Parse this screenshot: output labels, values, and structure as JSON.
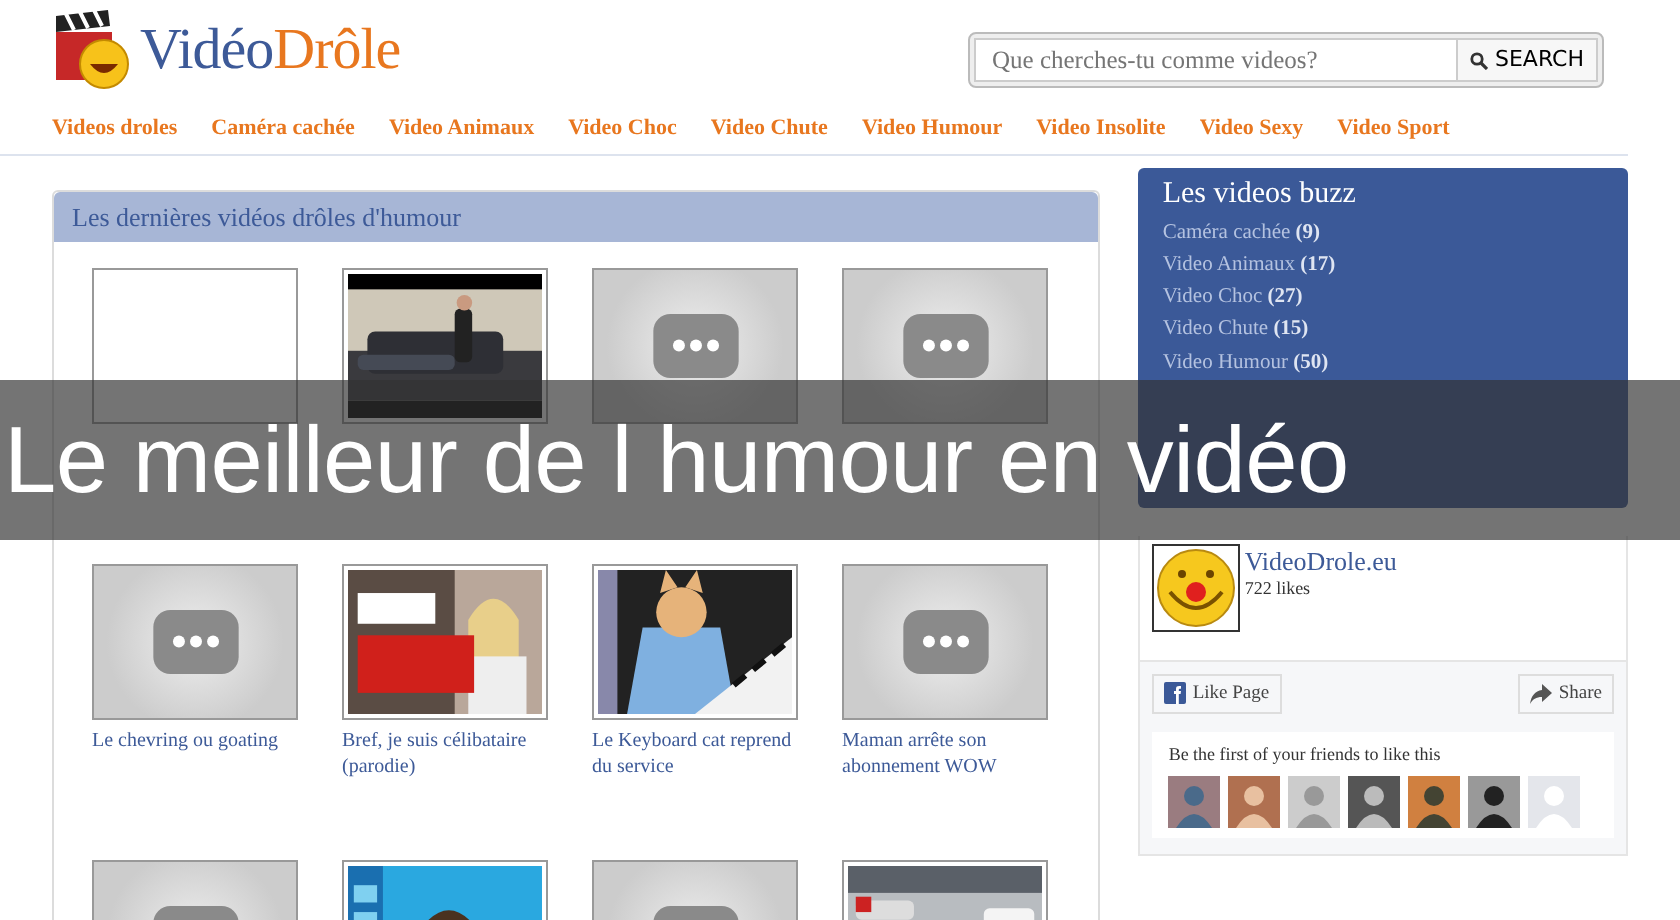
{
  "logo": {
    "part_1": "Vidéo",
    "part_2": "Drôle"
  },
  "search": {
    "placeholder": "Que cherches-tu comme videos?",
    "button": "SEARCH"
  },
  "nav": [
    "Videos droles",
    "Caméra cachée",
    "Video Animaux",
    "Video Choc",
    "Video Chute",
    "Video Humour",
    "Video Insolite",
    "Video Sexy",
    "Video Sport"
  ],
  "panel": {
    "title": "Les dernières vidéos drôles d'humour",
    "videos": [
      {
        "kind": "blank"
      },
      {
        "kind": "picture"
      },
      {
        "kind": "placeholder"
      },
      {
        "kind": "placeholder"
      },
      {
        "kind": "placeholder",
        "caption": "Le chevring ou goating"
      },
      {
        "kind": "picture",
        "caption": "Bref, je suis célibataire (parodie)"
      },
      {
        "kind": "picture",
        "caption": "Le Keyboard cat reprend du service"
      },
      {
        "kind": "placeholder",
        "caption": "Maman arrête son abonnement WOW"
      },
      {
        "kind": "placeholder"
      },
      {
        "kind": "picture"
      },
      {
        "kind": "placeholder"
      },
      {
        "kind": "picture"
      }
    ]
  },
  "buzz": {
    "title": "Les videos buzz",
    "items": [
      {
        "label": "Caméra cachée",
        "count": "(9)"
      },
      {
        "label": "Video Animaux",
        "count": "(17)"
      },
      {
        "label": "Video Choc",
        "count": "(27)"
      },
      {
        "label": "Video Chute",
        "count": "(15)"
      },
      {
        "label": "Video Humour",
        "count": "(50)"
      }
    ]
  },
  "facebook": {
    "page_name": "VideoDrole.eu",
    "likes": "722 likes",
    "like_button": "Like Page",
    "share_button": "Share",
    "friends_text": "Be the first of your friends to like this",
    "friends": [
      {
        "kind": "picture"
      },
      {
        "kind": "picture"
      },
      {
        "kind": "picture"
      },
      {
        "kind": "picture"
      },
      {
        "kind": "picture"
      },
      {
        "kind": "picture"
      },
      {
        "kind": "silhouette"
      }
    ]
  },
  "banner": {
    "text": "Le meilleur de l humour en vidéo"
  }
}
